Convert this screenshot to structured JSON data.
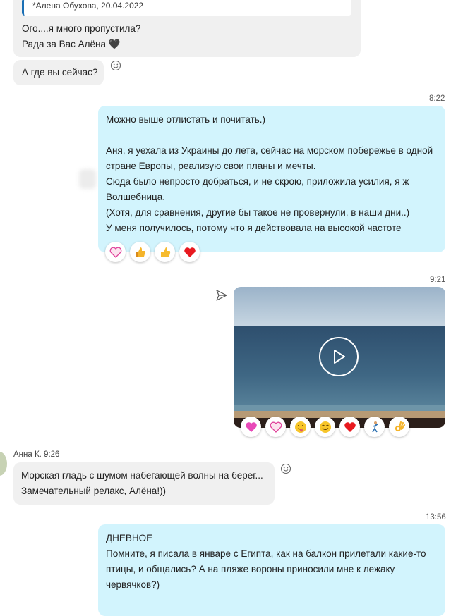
{
  "messages": {
    "m1": {
      "quote_author": "*Алена Обухова, 20.04.2022",
      "lines": [
        "Ого....я много пропустила?",
        "Рада за Вас Алёна 🖤"
      ]
    },
    "m2": {
      "text": "А где вы сейчас?"
    },
    "m3": {
      "time": "8:22",
      "lines": [
        "Можно выше отлистать и почитать.)",
        "",
        "Аня, я уехала из Украины до лета, сейчас на морском побережье в одной",
        "стране Европы, реализую свои планы и мечты.",
        "Сюда было непросто добраться, и не скрою, приложила усилия, я ж",
        "Волшебница.",
        "(Хотя, для сравнения, другие бы такое не провернули, в наши дни..)",
        "У меня получилось, потому что я действовала на высокой частоте"
      ],
      "reactions": [
        "heart-eyes-reaction",
        "thumbs-up-reaction",
        "like-reaction",
        "heart-reaction"
      ]
    },
    "m4": {
      "time": "9:21",
      "reactions": [
        "pink-heart-reaction",
        "heart-eyes-reaction",
        "tongue-face-reaction",
        "smile-reaction",
        "heart-reaction",
        "dancer-reaction",
        "ok-hand-reaction"
      ]
    },
    "m5": {
      "author_time": "Анна К. 9:26",
      "lines": [
        "Морская гладь с  шумом набегающей волны на берег...",
        "Замечательный релакс, Алёна!))"
      ]
    },
    "m6": {
      "time": "13:56",
      "lines": [
        "ДНЕВНОЕ",
        "Помните, я писала в январе с Египта, как на балкон прилетали какие-то",
        "птицы, и общались? А на пляже вороны приносили мне к лежаку",
        "червячков?)"
      ]
    }
  },
  "colors": {
    "incoming_bubble": "#f0f0f0",
    "outgoing_bubble": "#d2f4fd",
    "quote_bar": "#1a6fb5",
    "heart": "#e8191f"
  },
  "icons": {
    "react": "smiley-outline-icon",
    "forward": "send-arrow-icon",
    "play": "play-icon"
  }
}
